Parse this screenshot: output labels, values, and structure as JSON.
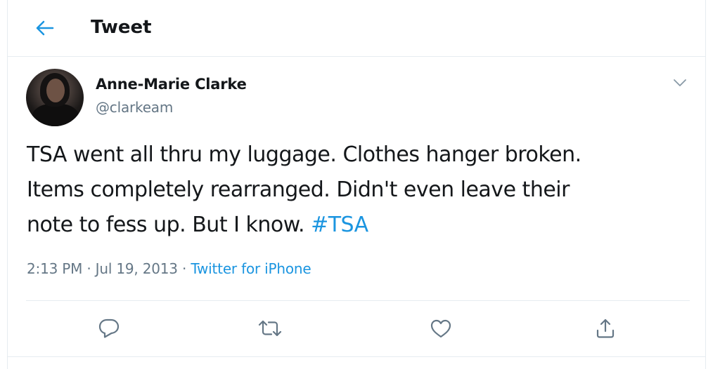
{
  "header": {
    "title": "Tweet",
    "back_icon": "arrow-left-icon"
  },
  "tweet": {
    "author": {
      "name": "Anne-Marie Clarke",
      "handle": "@clarkeam"
    },
    "text_lines": [
      "TSA went all thru my luggage. Clothes hanger broken.",
      "Items completely rearranged. Didn't even leave their",
      "note to fess up. But I know. "
    ],
    "hashtag": "#TSA",
    "time": "2:13 PM",
    "separator": " · ",
    "date": "Jul 19, 2013",
    "source": "Twitter for iPhone"
  },
  "actions": {
    "reply_icon": "reply-icon",
    "retweet_icon": "retweet-icon",
    "like_icon": "heart-icon",
    "share_icon": "share-icon"
  },
  "colors": {
    "accent": "#1b95e0",
    "text": "#14171a",
    "secondary": "#657786",
    "border": "#e6ecf0"
  }
}
